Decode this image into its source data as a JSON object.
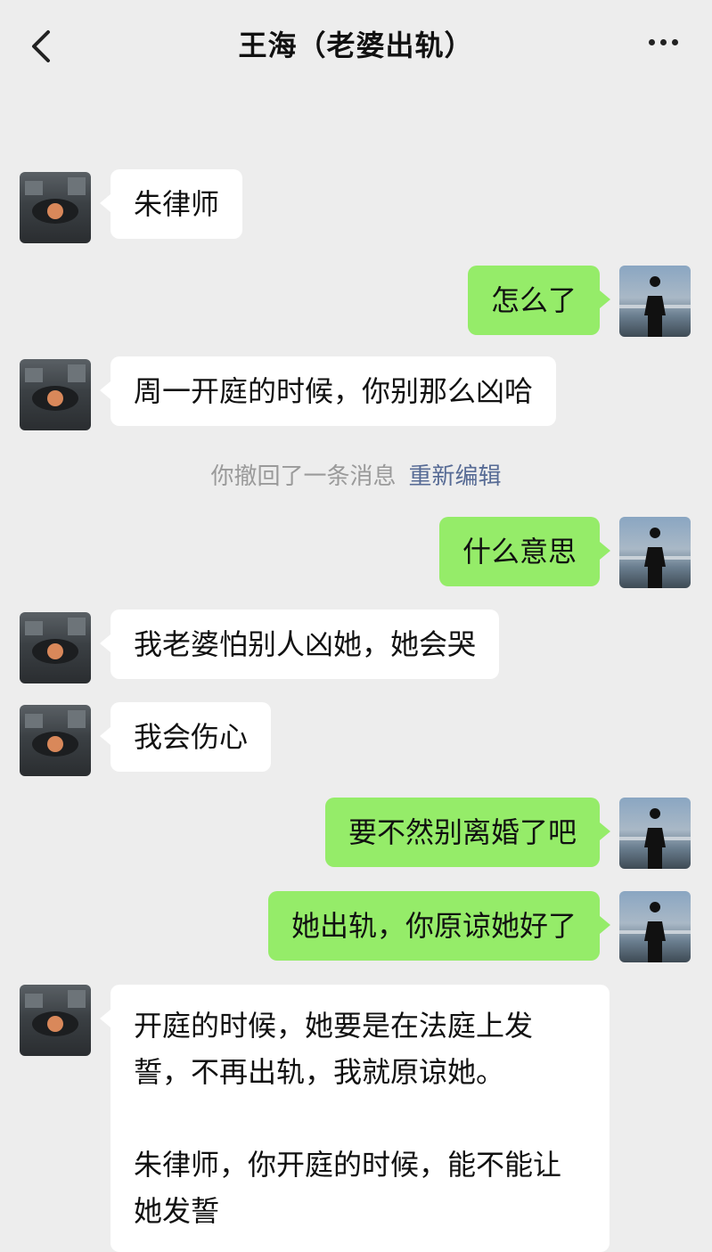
{
  "header": {
    "title": "王海（老婆出轨）"
  },
  "messages": [
    {
      "sender": "them",
      "text": "朱律师"
    },
    {
      "sender": "me",
      "text": "怎么了"
    },
    {
      "sender": "them",
      "text": "周一开庭的时候，你别那么凶哈"
    },
    {
      "system": "你撤回了一条消息",
      "action": "重新编辑"
    },
    {
      "sender": "me",
      "text": "什么意思"
    },
    {
      "sender": "them",
      "text": "我老婆怕别人凶她，她会哭"
    },
    {
      "sender": "them",
      "text": "我会伤心"
    },
    {
      "sender": "me",
      "text": "要不然别离婚了吧"
    },
    {
      "sender": "me",
      "text": "她出轨，你原谅她好了"
    },
    {
      "sender": "them",
      "paragraphs": [
        "开庭的时候，她要是在法庭上发誓，不再出轨，我就原谅她。",
        "朱律师，你开庭的时候，能不能让她发誓"
      ]
    }
  ]
}
